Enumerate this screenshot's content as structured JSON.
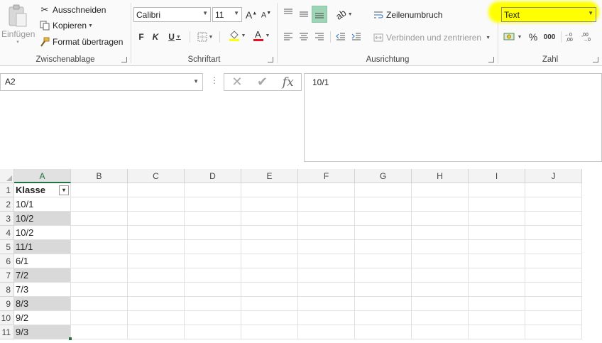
{
  "ribbon": {
    "clipboard": {
      "paste_label": "Einfügen",
      "cut_label": "Ausschneiden",
      "copy_label": "Kopieren",
      "format_painter_label": "Format übertragen",
      "group_label": "Zwischenablage"
    },
    "font": {
      "font_name": "Calibri",
      "font_size": "11",
      "bold_label": "F",
      "italic_label": "K",
      "underline_label": "U",
      "group_label": "Schriftart",
      "font_color": "#e81123"
    },
    "alignment": {
      "wrap_text_label": "Zeilenumbruch",
      "merge_center_label": "Verbinden und zentrieren",
      "group_label": "Ausrichtung"
    },
    "number": {
      "format_value": "Text",
      "percent_label": "%",
      "thousands_label": "000",
      "group_label": "Zahl",
      "highlight_color": "#ffff00"
    }
  },
  "formula_bar": {
    "name_box": "A2",
    "formula_value": "10/1"
  },
  "sheet": {
    "columns": [
      "A",
      "B",
      "C",
      "D",
      "E",
      "F",
      "G",
      "H",
      "I",
      "J"
    ],
    "selected_column": "A",
    "row_numbers": [
      "1",
      "2",
      "3",
      "4",
      "5",
      "6",
      "7",
      "8",
      "9",
      "10",
      "11"
    ],
    "header": "Klasse",
    "values": [
      "10/1",
      "10/2",
      "10/2",
      "11/1",
      "6/1",
      "7/2",
      "7/3",
      "8/3",
      "9/2",
      "9/3"
    ],
    "band_color": "#d9d9d9"
  }
}
